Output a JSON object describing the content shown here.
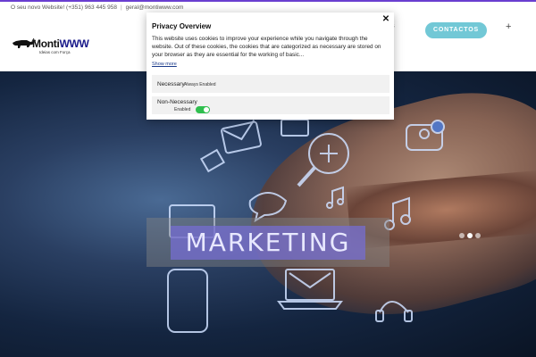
{
  "topbar": {
    "website_text": "O seu novo Website! (+351) 963 445 958",
    "email": "geral@montiwww.com"
  },
  "header": {
    "logo": {
      "name_monti": "Monti",
      "name_www": "WWW",
      "tagline": "Ideias com Força"
    },
    "nav_partial": "ctos",
    "contact_label": "CONTACTOS",
    "plus_icon": "plus-icon"
  },
  "hero": {
    "banner_text": "MARKETING",
    "slider": {
      "count": 3,
      "active": 1
    }
  },
  "privacy_modal": {
    "title": "Privacy Overview",
    "body": "This website uses cookies to improve your experience while you navigate through the website. Out of these cookies, the cookies that are categorized as necessary are stored on your browser as they are essential for the working of basic...",
    "show_more": "Show more",
    "close_icon": "close-icon",
    "rows": [
      {
        "name": "Necessary",
        "status": "Always Enabled"
      },
      {
        "name": "Non-Necessary",
        "status": "Enabled"
      }
    ]
  },
  "colors": {
    "accent_line": "#6a3fd0",
    "contact_button": "#72c8d6",
    "toggle_on": "#2fbf4e",
    "marketing_band": "#766ed2"
  }
}
